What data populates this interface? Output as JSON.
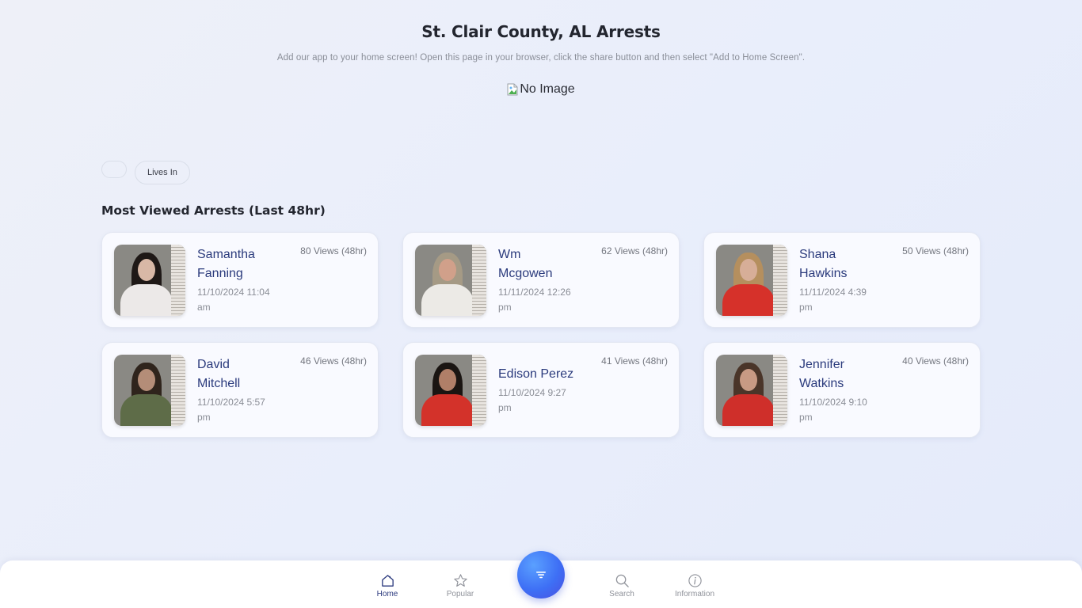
{
  "header": {
    "title": "St. Clair County, AL Arrests",
    "subtitle": "Add our app to your home screen! Open this page in your browser, click the share button and then select \"Add to Home Screen\".",
    "banner_alt": "No Image"
  },
  "filters": {
    "chips": [
      {
        "label": ""
      },
      {
        "label": "Lives In"
      }
    ]
  },
  "section": {
    "title": "Most Viewed Arrests (Last 48hr)"
  },
  "arrests": [
    {
      "first": "Samantha",
      "last": "Fanning",
      "date": "11/10/2024 11:04",
      "ampm": "am",
      "views": "80 Views (48hr)",
      "photo": {
        "hair": "#1e1816",
        "skin": "#d8b8a6",
        "shirt": "#ece9e8"
      }
    },
    {
      "first": "Wm",
      "last": "Mcgowen",
      "date": "11/11/2024 12:26",
      "ampm": "pm",
      "views": "62 Views (48hr)",
      "photo": {
        "hair": "#a59a85",
        "skin": "#d1a08a",
        "shirt": "#eceae6"
      }
    },
    {
      "first": "Shana",
      "last": "Hawkins",
      "date": "11/11/2024 4:39",
      "ampm": "pm",
      "views": "50 Views (48hr)",
      "photo": {
        "hair": "#b58f5e",
        "skin": "#d7ae98",
        "shirt": "#d6312a"
      }
    },
    {
      "first": "David",
      "last": "Mitchell",
      "date": "11/10/2024 5:57",
      "ampm": "pm",
      "views": "46 Views (48hr)",
      "photo": {
        "hair": "#2f241c",
        "skin": "#b48d78",
        "shirt": "#5e6c48"
      }
    },
    {
      "first": "Edison Perez",
      "last": "",
      "date": "11/10/2024 9:27",
      "ampm": "pm",
      "views": "41 Views (48hr)",
      "photo": {
        "hair": "#1a1512",
        "skin": "#b07f68",
        "shirt": "#d3322a"
      }
    },
    {
      "first": "Jennifer",
      "last": "Watkins",
      "date": "11/10/2024 9:10",
      "ampm": "pm",
      "views": "40 Views (48hr)",
      "photo": {
        "hair": "#4a3529",
        "skin": "#c89a84",
        "shirt": "#cf2f2a"
      }
    }
  ],
  "nav": {
    "items": [
      {
        "label": "Home",
        "icon": "home-icon",
        "active": true
      },
      {
        "label": "Popular",
        "icon": "star-icon",
        "active": false
      },
      {
        "label": "Search",
        "icon": "search-icon",
        "active": false
      },
      {
        "label": "Information",
        "icon": "info-icon",
        "active": false
      }
    ],
    "fab_icon": "filter-icon"
  },
  "colors": {
    "accent": "#3e6ff5",
    "name_text": "#2a3a7c",
    "active_nav": "#2c3a7e"
  }
}
